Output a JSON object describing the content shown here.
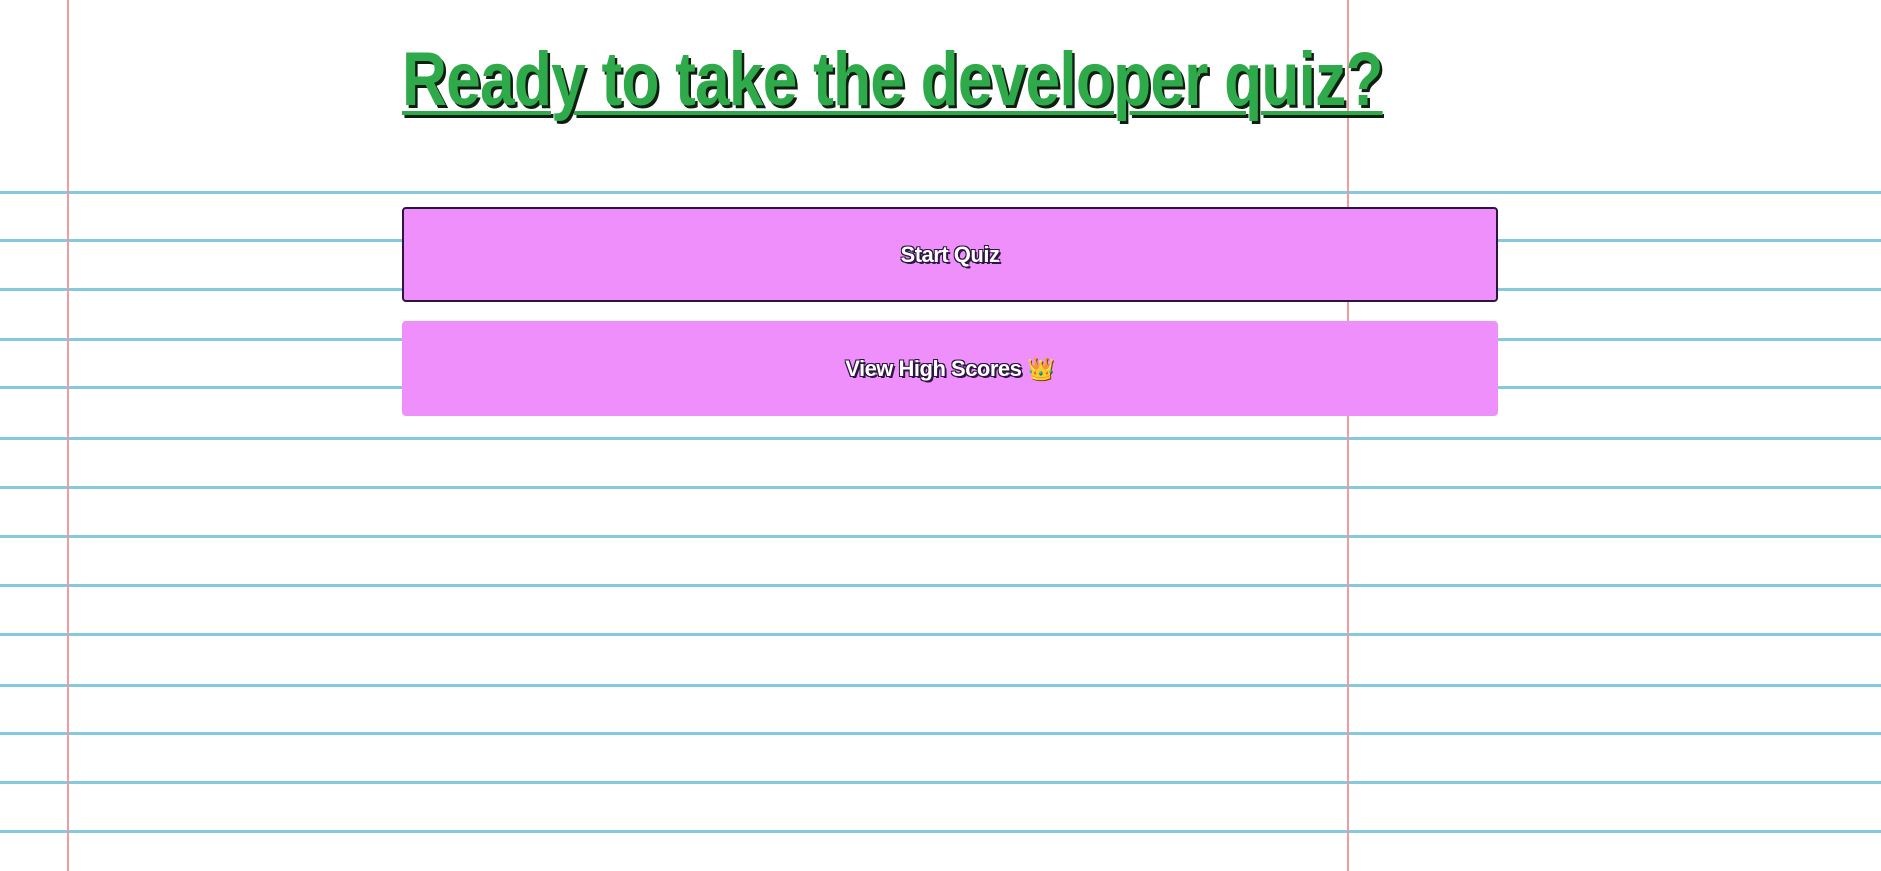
{
  "page": {
    "title": "Ready to take the developer quiz?"
  },
  "actions": {
    "start_label": "Start Quiz",
    "scores_label": "View High Scores",
    "scores_icon": "👑"
  },
  "colors": {
    "title": "#2eaa4a",
    "button": "#ef8ffc",
    "rule_line": "#86c8de",
    "margin_line": "#ec9e9a"
  },
  "icons": {
    "scores_icon_name": "crown-icon"
  }
}
